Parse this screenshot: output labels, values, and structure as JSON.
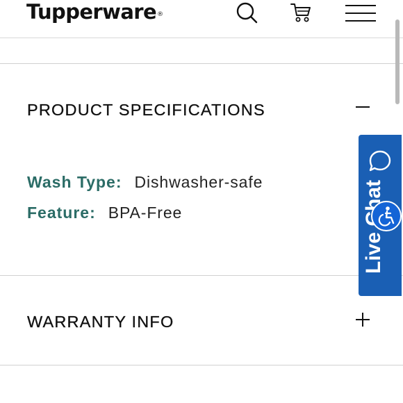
{
  "header": {
    "logo_text": "Tupperware",
    "logo_mark": "®",
    "icons": [
      "search-icon",
      "cart-icon",
      "menu-icon"
    ]
  },
  "product_specifications": {
    "title": "PRODUCT SPECIFICATIONS",
    "toggle": "collapse",
    "specs": [
      {
        "label": "Wash Type:",
        "value": "Dishwasher-safe"
      },
      {
        "label": "Feature:",
        "value": "BPA-Free"
      }
    ]
  },
  "warranty_info": {
    "title": "WARRANTY INFO",
    "toggle": "expand"
  },
  "live_chat": {
    "label": "Live Chat",
    "icon": "chat-bubble-icon"
  },
  "accessibility": {
    "icon": "accessibility-icon"
  },
  "colors": {
    "label_teal": "#2b6c66",
    "chat_blue": "#1a5fb4",
    "accessibility_blue": "#1464d6",
    "divider": "#d0d0d0"
  }
}
